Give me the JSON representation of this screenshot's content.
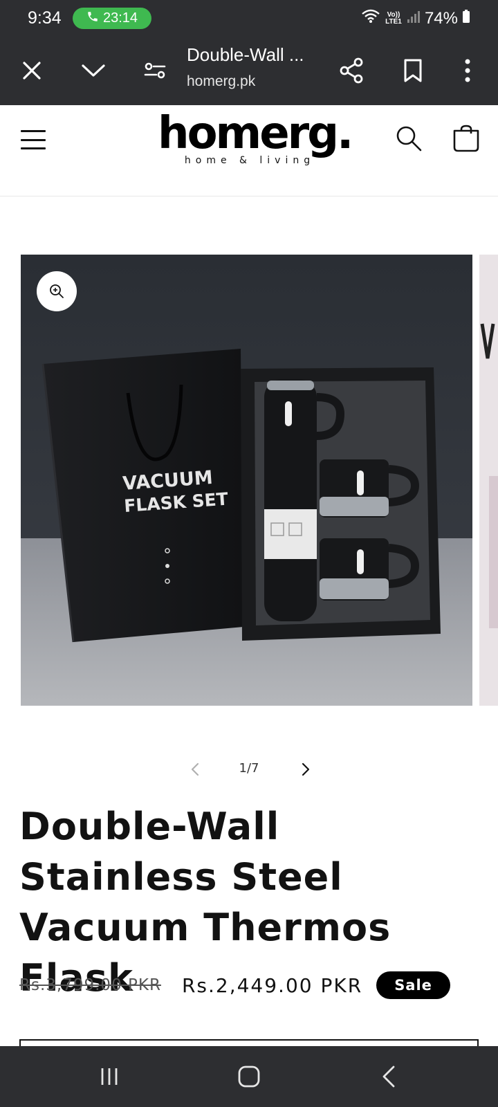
{
  "status_bar": {
    "time": "9:34",
    "call_timer": "23:14",
    "network_label": "Vo)) LTE1",
    "battery": "74%"
  },
  "browser": {
    "tab_title": "Double-Wall ...",
    "url": "homerg.pk"
  },
  "site_header": {
    "logo_text": "homerg.",
    "logo_tagline": "home & living"
  },
  "gallery": {
    "bag_text_line1": "VACUUM",
    "bag_text_line2": "FLASK SET",
    "counter": "1/7"
  },
  "product": {
    "title": "Double-Wall Stainless Steel Vacuum Thermos Flask",
    "price_regular": "Rs.3,799.00 PKR",
    "price_sale": "Rs.2,449.00 PKR",
    "badge": "Sale"
  },
  "colors": {
    "system_bar": "#2d2e31",
    "call_green": "#3fb950",
    "text": "#121212",
    "badge_bg": "#000000"
  }
}
